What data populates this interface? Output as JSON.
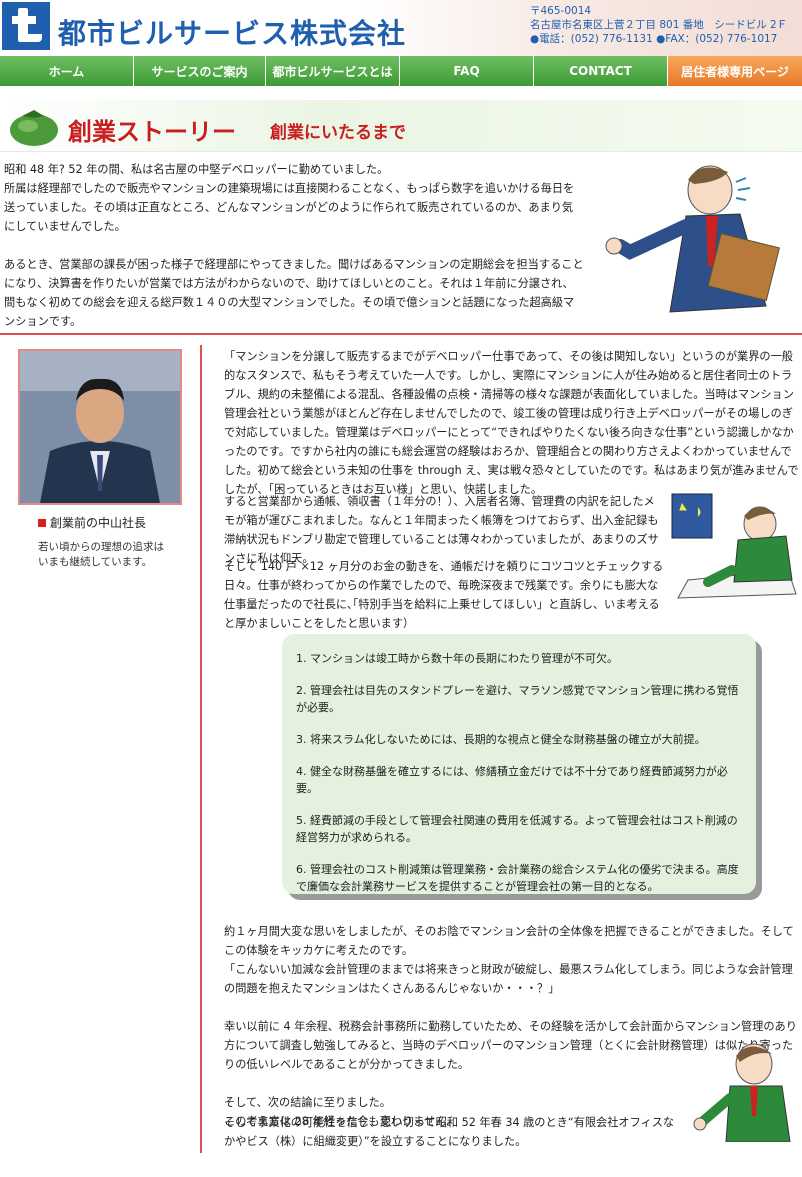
{
  "header": {
    "company_name": "都市ビルサービス株式会社",
    "postal": "〒465-0014",
    "address": "名古屋市名東区上菅２丁目 801 番地　シードビル 2Ｆ",
    "contact": "●電話：(052) 776-1131 ●FAX：(052) 776-1017"
  },
  "nav": [
    {
      "label": "ホーム"
    },
    {
      "label": "サービスのご案内"
    },
    {
      "label": "都市ビルサービスとは"
    },
    {
      "label": "FAQ"
    },
    {
      "label": "CONTACT"
    },
    {
      "label": "居住者様専用ページ"
    }
  ],
  "page_title": {
    "main": "創業ストーリー",
    "sub": "創業にいたるまで"
  },
  "intro": [
    "昭和 48 年? 52 年の間、私は名古屋の中堅デベロッパーに勤めていました。",
    "所属は経理部でしたので販売やマンションの建築現場には直接関わることなく、もっぱら数字を追いかける毎日を送っていました。その頃は正直なところ、どんなマンションがどのように作られて販売されているのか、あまり気にしていませんでした。",
    "あるとき、営業部の課長が困った様子で経理部にやってきました。聞けばあるマンションの定期総会を担当することになり、決算書を作りたいが営業では方法がわからないので、助けてほしいとのこと。それは１年前に分譲され、間もなく初めての総会を迎える総戸数１４０の大型マンションでした。その頃で億ションと話題になった超高級マンションです。"
  ],
  "profile": {
    "caption": "創業前の中山社長",
    "note_line1": "若い頃からの理想の追求は",
    "note_line2": "いまも継続しています。"
  },
  "body1": "「マンションを分譲して販売するまでがデベロッパー仕事であって、その後は関知しない」というのが業界の一般的なスタンスで、私もそう考えていた一人です。しかし、実際にマンションに人が住み始めると居住者同士のトラブル、規約の未整備による混乱、各種設備の点検・清掃等の様々な課題が表面化していました。当時はマンション管理会社という業態がほとんど存在しませんでしたので、竣工後の管理は成り行き上デベロッパーがその場しのぎで対応していました。管理業はデベロッパーにとって“できればやりたくない後ろ向きな仕事”という認識しかなかったのです。ですから社内の誰にも総会運営の経験はおろか、管理組合との関わり方さえよくわかっていませんでした。初めて総会という未知の仕事を through え、実は戦々恐々としていたのです。私はあまり気が進みませんでしたが、「困っているときはお互い様」と思い、快諾しました。",
  "body2": "すると営業部から通帳、領収書（１年分の！）、入居者名簿、管理費の内訳を記したメモが箱が運びこまれました。なんと１年間まったく帳簿をつけておらず、出入金記録も滞納状況もドンブリ勘定で管理していることは薄々わかっていましたが、あまりのズサンさに私は仰天。",
  "body3": "そして 140 戸 ×12 ヶ月分のお金の動きを、通帳だけを頼りにコツコツとチェックする日々。仕事が終わってからの作業でしたので、毎晩深夜まで残業です。余りにも膨大な仕事量だったので社長に､｢特別手当を給料に上乗せしてほしい」と直訴し、いま考えると厚かましいことをしたと思います）",
  "conclusions": [
    "1. マンションは竣工時から数十年の長期にわたり管理が不可欠。",
    "2. 管理会社は目先のスタンドプレーを避け、マラソン感覚でマンション管理に携わる覚悟が必要。",
    "3. 将来スラム化しないためには、長期的な視点と健全な財務基盤の確立が大前提。",
    "4. 健全な財務基盤を確立するには、修繕積立金だけでは不十分であり経費節減努力が必要。",
    "5. 経費節減の手段として管理会社関連の費用を低減する。よって管理会社はコスト削減の経営努力が求められる。",
    "6. 管理会社のコスト削減策は管理業務・会計業務の総合システム化の優劣で決まる。高度で廉価な会計業務サービスを提供することが管理会社の第一目的となる。"
  ],
  "body4": [
    "約１ヶ月間大変な思いをしましたが、そのお陰でマンション会計の全体像を把握できることができました。そしてこの体験をキッカケに考えたのです。",
    "「こんないい加減な会計管理のままでは将来きっと財政が破綻し、最悪スラム化してしまう。同じような会計管理の問題を抱えたマンションはたくさんあるんじゃないか・・・？」",
    "幸い以前に 4 年余程、税務会計事務所に勤務していたため、その経験を活かして会計面からマンション管理のあり方について調査し勉強してみると、当時のデベロッパーのマンション管理（とくに会計財務管理）は似たり寄ったりの低いレベルであることが分かってきました。",
    "そして、次の結論に至りました。",
    "この考え方は 28 年経った今も変わりません。"
  ],
  "body5": "そして事業化の可能性を信じ、思い切って昭和 52 年春 34 歳のとき“有限会社オフィスなかやビス（株）に組織変更）”を設立することになりました。",
  "colors": {
    "brand_blue": "#1f5fae",
    "nav_green": "#4aa843",
    "nav_orange": "#ef8a3a",
    "title_red": "#c81e1e",
    "rule_red": "#e05050",
    "box_green": "#e3f1de"
  }
}
